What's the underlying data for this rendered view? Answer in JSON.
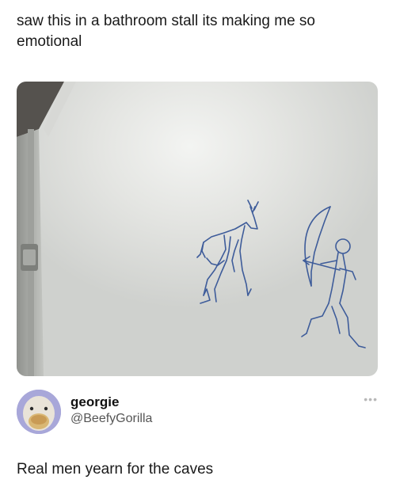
{
  "post": {
    "caption": "saw this in a bathroom stall its making me so emotional"
  },
  "photo": {
    "subject": "bathroom-stall-cave-drawing"
  },
  "comment": {
    "name": "georgie",
    "handle": "@BeefyGorilla",
    "more_icon": "more-dots-icon",
    "text": "Real men yearn for the caves"
  }
}
